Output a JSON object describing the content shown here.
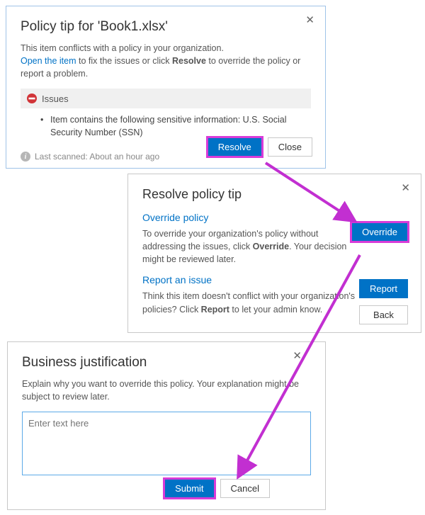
{
  "dlg1": {
    "title": "Policy tip for 'Book1.xlsx'",
    "desc1": "This item conflicts with a policy in your organization.",
    "open_link": "Open the item",
    "desc2_a": " to fix the issues or click ",
    "desc2_bold": "Resolve",
    "desc2_b": " to override the policy or report a problem.",
    "issues_label": "Issues",
    "issue1": "Item contains the following sensitive information: U.S. Social Security Number (SSN)",
    "scan_text": "Last scanned: About an hour ago",
    "resolve_btn": "Resolve",
    "close_btn": "Close"
  },
  "dlg2": {
    "title": "Resolve policy tip",
    "override_head": "Override policy",
    "override_desc_a": "To override your organization's policy without addressing the issues, click ",
    "override_bold": "Override",
    "override_desc_b": ". Your decision might be reviewed later.",
    "report_head": "Report an issue",
    "report_desc_a": "Think this item doesn't conflict with your organization's policies? Click ",
    "report_bold": "Report",
    "report_desc_b": " to let your admin know.",
    "override_btn": "Override",
    "report_btn": "Report",
    "back_btn": "Back"
  },
  "dlg3": {
    "title": "Business justification",
    "desc": "Explain why you want to override this policy. Your explanation might be subject to review later.",
    "placeholder": "Enter text here",
    "submit_btn": "Submit",
    "cancel_btn": "Cancel"
  }
}
